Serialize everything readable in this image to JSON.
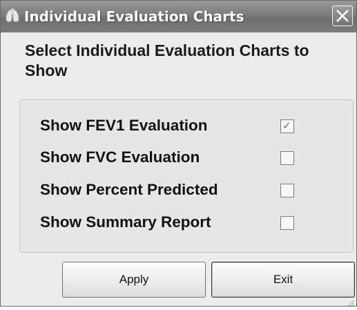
{
  "window": {
    "title": "Individual Evaluation Charts",
    "icon": "lungs-icon",
    "close_glyph": "✕"
  },
  "heading": "Select Individual Evaluation Charts to Show",
  "options": [
    {
      "label": "Show FEV1 Evaluation",
      "checked": true
    },
    {
      "label": "Show FVC Evaluation",
      "checked": false
    },
    {
      "label": "Show Percent Predicted",
      "checked": false
    },
    {
      "label": "Show Summary Report",
      "checked": false
    }
  ],
  "buttons": {
    "apply": "Apply",
    "exit": "Exit"
  },
  "colors": {
    "titlebar": "#7c7c7c",
    "window_bg": "#ececec",
    "group_bg": "#e6e6e6"
  }
}
